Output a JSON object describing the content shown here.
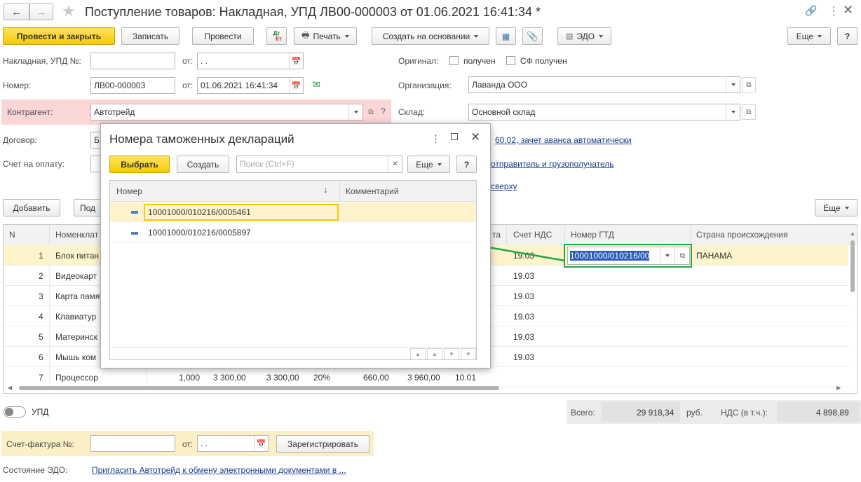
{
  "window": {
    "title": "Поступление товаров: Накладная, УПД ЛВ00-000003 от 01.06.2021 16:41:34 *"
  },
  "toolbar": {
    "post_close": "Провести и закрыть",
    "save": "Записать",
    "post": "Провести",
    "dt_kt_top": "Дт",
    "dt_kt_bottom": "Кт",
    "print": "Печать",
    "create_based": "Создать на основании",
    "edo": "ЭДО",
    "more": "Еще",
    "help": "?"
  },
  "header": {
    "invoice_label": "Накладная, УПД №:",
    "invoice_value": "",
    "from_label": "от:",
    "invoice_date": " .  .",
    "number_label": "Номер:",
    "number_value": "ЛВ00-000003",
    "number_date": "01.06.2021 16:41:34",
    "counterparty_label": "Контрагент:",
    "counterparty_value": "Автотрейд",
    "contract_label": "Договор:",
    "contract_value": "Б",
    "payment_label": "Счет на оплату:",
    "original_label": "Оригинал:",
    "received_label": "получен",
    "sf_received_label": "СФ получен",
    "org_label": "Организация:",
    "org_value": "Лаванда ООО",
    "warehouse_label": "Склад:",
    "warehouse_value": "Основной склад",
    "link1": "60.02, зачет аванса автоматически",
    "link2": "отправитель и грузополучатель",
    "link3": "сверху"
  },
  "table_toolbar": {
    "add": "Добавить",
    "pick": "Под",
    "more": "Еще"
  },
  "table": {
    "columns": {
      "n": "N",
      "name": "Номенклат",
      "sum_cut": "та",
      "vat_account": "Счет НДС",
      "gtd": "Номер ГТД",
      "country": "Страна происхождения"
    },
    "rows": [
      {
        "n": "1",
        "name": "Блок питан",
        "qty": "",
        "price": "",
        "sum": "",
        "rate": "",
        "vat": "",
        "total": "",
        "account": "19.03",
        "gtd": "10001000/010216/00",
        "country": "ПАНАМА"
      },
      {
        "n": "2",
        "name": "Видеокарт",
        "qty": "",
        "price": "",
        "sum": "",
        "rate": "",
        "vat": "",
        "total": "",
        "account": "19.03",
        "gtd": "",
        "country": ""
      },
      {
        "n": "3",
        "name": "Карта памя",
        "qty": "",
        "price": "",
        "sum": "",
        "rate": "",
        "vat": "",
        "total": "",
        "account": "19.03",
        "gtd": "",
        "country": ""
      },
      {
        "n": "4",
        "name": "Клавиатур",
        "qty": "",
        "price": "",
        "sum": "",
        "rate": "",
        "vat": "",
        "total": "",
        "account": "19.03",
        "gtd": "",
        "country": ""
      },
      {
        "n": "5",
        "name": "Материнск",
        "qty": "",
        "price": "",
        "sum": "",
        "rate": "",
        "vat": "",
        "total": "",
        "account": "19.03",
        "gtd": "",
        "country": ""
      },
      {
        "n": "6",
        "name": "Мышь ком",
        "qty": "",
        "price": "",
        "sum": "",
        "rate": "",
        "vat": "",
        "total": "",
        "account": "19.03",
        "gtd": "",
        "country": ""
      },
      {
        "n": "7",
        "name": "Процессор",
        "qty": "1,000",
        "price": "3 300,00",
        "sum": "3 300,00",
        "rate": "20%",
        "vat": "660,00",
        "total": "3 960,00",
        "account": "10.01",
        "gtd": "",
        "country": ""
      }
    ]
  },
  "footer": {
    "upd_label": "УПД",
    "total_label": "Всего:",
    "total_value": "29 918,34",
    "currency": "руб.",
    "vat_label": "НДС (в т.ч.):",
    "vat_value": "4 898,89",
    "sf_label": "Счет-фактура №:",
    "sf_from": "от:",
    "sf_date": " .  .",
    "register": "Зарегистрировать",
    "edo_label": "Состояние ЭДО:",
    "edo_link": "Пригласить Автотрейд к обмену электронными документами в ..."
  },
  "dialog": {
    "title": "Номера таможенных деклараций",
    "select": "Выбрать",
    "create": "Создать",
    "search_placeholder": "Поиск (Ctrl+F)",
    "more": "Еще",
    "help": "?",
    "col_number": "Номер",
    "col_comment": "Комментарий",
    "rows": [
      {
        "number": "10001000/010216/0005461",
        "comment": ""
      },
      {
        "number": "10001000/010216/0005897",
        "comment": ""
      }
    ]
  },
  "colors": {
    "accent_yellow": "#f6c90e",
    "selected_row": "#fdf3cc",
    "highlight_green": "#21a84a",
    "counterparty_bg": "#fbd6d6",
    "link": "#1a3f91"
  }
}
